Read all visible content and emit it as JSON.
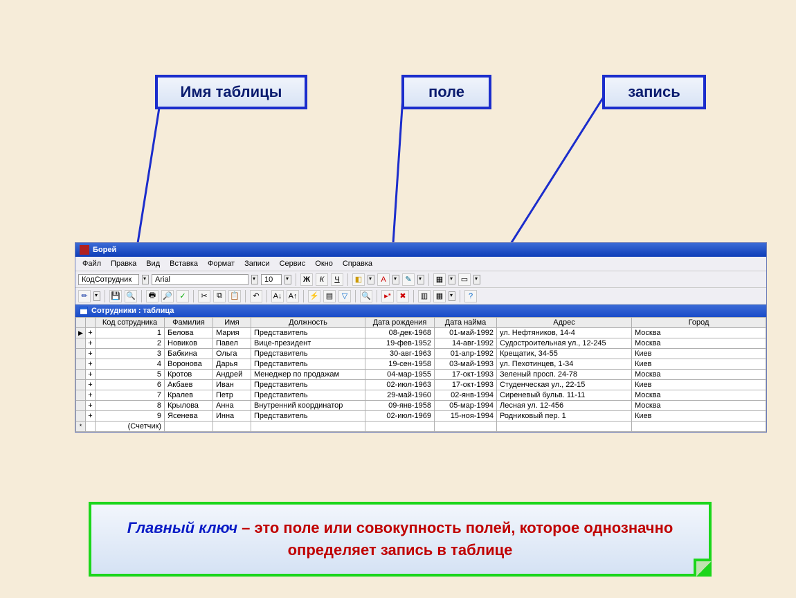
{
  "callouts": {
    "table_name": "Имя таблицы",
    "field": "поле",
    "record": "запись"
  },
  "app": {
    "title": "Борей",
    "menus": [
      "Файл",
      "Правка",
      "Вид",
      "Вставка",
      "Формат",
      "Записи",
      "Сервис",
      "Окно",
      "Справка"
    ],
    "toolbar1": {
      "field_selector": "КодСотрудник",
      "font_name": "Arial",
      "font_size": "10",
      "bold": "Ж",
      "italic": "К",
      "underline": "Ч"
    },
    "subwindow_title": "Сотрудники : таблица",
    "columns": [
      "Код сотрудника",
      "Фамилия",
      "Имя",
      "Должность",
      "Дата рождения",
      "Дата найма",
      "Адрес",
      "Город"
    ],
    "rows": [
      {
        "id": "1",
        "last": "Белова",
        "first": "Мария",
        "title": "Представитель",
        "dob": "08-дек-1968",
        "hire": "01-май-1992",
        "addr": "ул. Нефтяников, 14-4",
        "city": "Москва"
      },
      {
        "id": "2",
        "last": "Новиков",
        "first": "Павел",
        "title": "Вице-президент",
        "dob": "19-фев-1952",
        "hire": "14-авг-1992",
        "addr": "Судостроительная ул., 12-245",
        "city": "Москва"
      },
      {
        "id": "3",
        "last": "Бабкина",
        "first": "Ольга",
        "title": "Представитель",
        "dob": "30-авг-1963",
        "hire": "01-апр-1992",
        "addr": "Крещатик, 34-55",
        "city": "Киев"
      },
      {
        "id": "4",
        "last": "Воронова",
        "first": "Дарья",
        "title": "Представитель",
        "dob": "19-сен-1958",
        "hire": "03-май-1993",
        "addr": "ул. Пехотинцев, 1-34",
        "city": "Киев"
      },
      {
        "id": "5",
        "last": "Кротов",
        "first": "Андрей",
        "title": "Менеджер по продажам",
        "dob": "04-мар-1955",
        "hire": "17-окт-1993",
        "addr": "Зеленый просп. 24-78",
        "city": "Москва"
      },
      {
        "id": "6",
        "last": "Акбаев",
        "first": "Иван",
        "title": "Представитель",
        "dob": "02-июл-1963",
        "hire": "17-окт-1993",
        "addr": "Студенческая ул., 22-15",
        "city": "Киев"
      },
      {
        "id": "7",
        "last": "Кралев",
        "first": "Петр",
        "title": "Представитель",
        "dob": "29-май-1960",
        "hire": "02-янв-1994",
        "addr": "Сиреневый бульв. 11-11",
        "city": "Москва"
      },
      {
        "id": "8",
        "last": "Крылова",
        "first": "Анна",
        "title": "Внутренний координатор",
        "dob": "09-янв-1958",
        "hire": "05-мар-1994",
        "addr": "Лесная ул. 12-456",
        "city": "Москва"
      },
      {
        "id": "9",
        "last": "Ясенева",
        "first": "Инна",
        "title": "Представитель",
        "dob": "02-июл-1969",
        "hire": "15-ноя-1994",
        "addr": "Родниковый пер. 1",
        "city": "Киев"
      }
    ],
    "new_row_placeholder": "(Счетчик)"
  },
  "definition": {
    "keyword": "Главный ключ",
    "dash": " – ",
    "text": "это поле или совокупность полей, которое однозначно определяет запись в таблице"
  }
}
